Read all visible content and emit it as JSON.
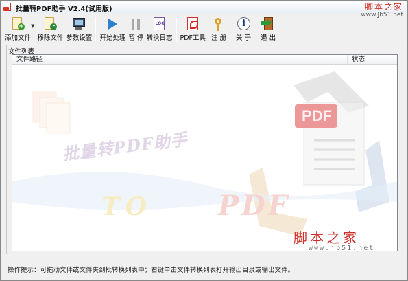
{
  "window": {
    "title": "批量转PDF助手 V2.4(试用版)"
  },
  "watermark": {
    "site_cn": "脚本之家",
    "site_url": "www.Jb51.net"
  },
  "toolbar": {
    "items": [
      {
        "label": "添加文件",
        "icon": "add-file-icon"
      },
      {
        "label": "移除文件",
        "icon": "remove-file-icon"
      },
      {
        "label": "参数设置",
        "icon": "settings-monitor-icon"
      },
      {
        "label": "开始处理",
        "icon": "play-icon"
      },
      {
        "label": "暂 停",
        "icon": "pause-icon"
      },
      {
        "label": "转换日志",
        "icon": "log-icon"
      },
      {
        "label": "PDF工具",
        "icon": "pdf-icon"
      },
      {
        "label": "注 册",
        "icon": "key-icon"
      },
      {
        "label": "关 于",
        "icon": "info-icon"
      },
      {
        "label": "退 出",
        "icon": "exit-icon"
      }
    ],
    "dropdown_glyph": "▼"
  },
  "file_list": {
    "group_title": "文件列表",
    "columns": {
      "path": "文件路径",
      "status": "状态"
    },
    "rows": []
  },
  "background_art": {
    "headline": "批量转PDF助手",
    "to_text": "TO",
    "pdf_text": "PDF",
    "pdf_badge": "PDF",
    "wm_cn": "脚本之家",
    "wm_url": "www.jb51.net"
  },
  "status": {
    "hint": "操作提示：可拖动文件或文件夹到批转换列表中；右键单击文件转换列表打开输出目录或输出文件。"
  },
  "colors": {
    "accent_blue": "#2f7fd0",
    "pdf_red": "#d22222",
    "watermark_red": "#d0302a"
  }
}
